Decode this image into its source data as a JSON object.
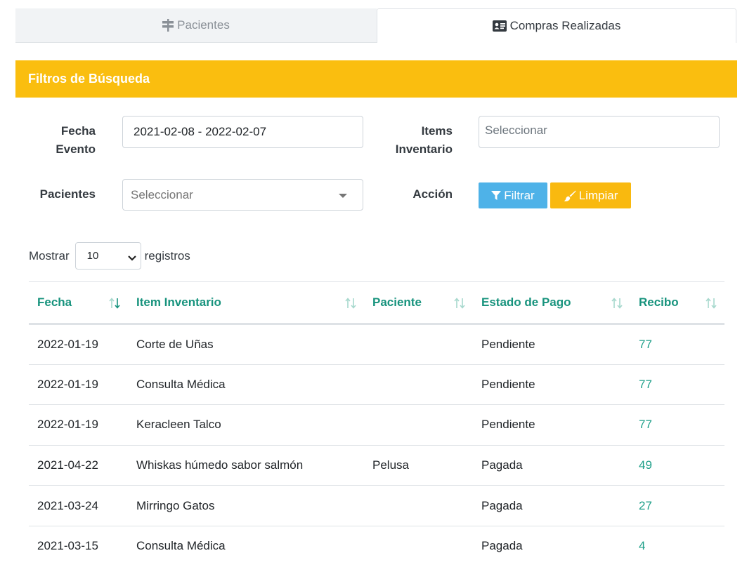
{
  "tabs": [
    {
      "label": "Pacientes",
      "icon": "signpost-icon",
      "active": false
    },
    {
      "label": "Compras Realizadas",
      "icon": "id-card-icon",
      "active": true
    }
  ],
  "filters": {
    "title": "Filtros de Búsqueda",
    "fecha_label_line1": "Fecha",
    "fecha_label_line2": "Evento",
    "fecha_value": "2021-02-08 - 2022-02-07",
    "items_label_line1": "Items",
    "items_label_line2": "Inventario",
    "items_placeholder": "Seleccionar",
    "pacientes_label": "Pacientes",
    "pacientes_placeholder": "Seleccionar",
    "accion_label": "Acción",
    "filtrar_label": "Filtrar",
    "limpiar_label": "Limpiar"
  },
  "length": {
    "prefix": "Mostrar",
    "value": "10",
    "suffix": "registros"
  },
  "table": {
    "columns": [
      "Fecha",
      "Item Inventario",
      "Paciente",
      "Estado de Pago",
      "Recibo"
    ],
    "rows": [
      [
        "2022-01-19",
        "Corte de Uñas",
        "",
        "Pendiente",
        "77"
      ],
      [
        "2022-01-19",
        "Consulta Médica",
        "",
        "Pendiente",
        "77"
      ],
      [
        "2022-01-19",
        "Keracleen Talco",
        "",
        "Pendiente",
        "77"
      ],
      [
        "2021-04-22",
        "Whiskas húmedo sabor salmón",
        "Pelusa",
        "Pagada",
        "49"
      ],
      [
        "2021-03-24",
        "Mirringo Gatos",
        "",
        "Pagada",
        "27"
      ],
      [
        "2021-03-15",
        "Consulta Médica",
        "",
        "Pagada",
        "4"
      ]
    ]
  },
  "colors": {
    "accent_yellow": "#fabe0f",
    "filter_blue": "#4eb2e8",
    "header_teal": "#17937d"
  }
}
